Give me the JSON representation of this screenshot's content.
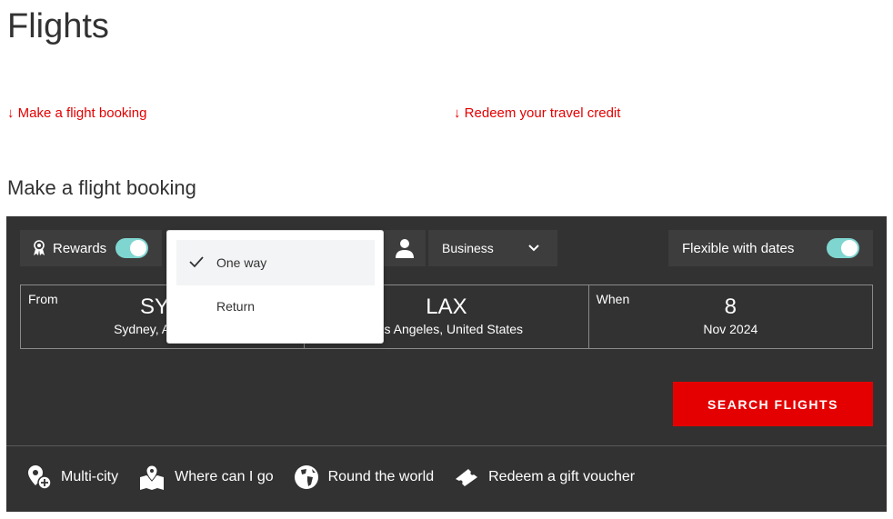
{
  "page": {
    "title": "Flights",
    "section_title": "Make a flight booking"
  },
  "jump_links": [
    {
      "label": "Make a flight booking",
      "icon": "arrow-down-icon"
    },
    {
      "label": "Redeem your travel credit",
      "icon": "arrow-down-icon"
    }
  ],
  "toolbar": {
    "rewards_label": "Rewards",
    "rewards_on": true,
    "cabin": "Business",
    "flexible_label": "Flexible with dates",
    "flexible_on": true
  },
  "trip_type_menu": {
    "options": [
      {
        "label": "One way",
        "selected": true
      },
      {
        "label": "Return",
        "selected": false
      }
    ]
  },
  "fields": {
    "from_label": "From",
    "from_code": "SYD",
    "from_city": "Sydney, Australia",
    "to_code": "LAX",
    "to_city": "Los Angeles, United States",
    "when_label": "When",
    "when_day": "8",
    "when_month": "Nov 2024"
  },
  "search_label": "SEARCH FLIGHTS",
  "links": [
    {
      "label": "Multi-city",
      "icon": "pin-plus-icon"
    },
    {
      "label": "Where can I go",
      "icon": "map-pin-icon"
    },
    {
      "label": "Round the world",
      "icon": "globe-icon"
    },
    {
      "label": "Redeem a gift voucher",
      "icon": "ticket-icon"
    }
  ],
  "colors": {
    "accent": "#e40000",
    "panel": "#323232",
    "toggle": "#7fd6d1"
  }
}
